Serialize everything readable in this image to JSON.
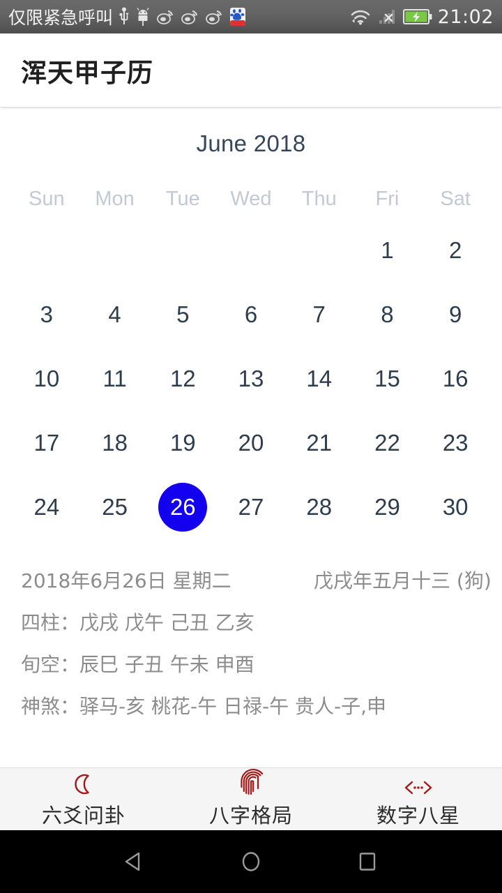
{
  "statusbar": {
    "carrier": "仅限紧急呼叫",
    "clock": "21:02",
    "left_icons": [
      "usb-icon",
      "android-robot-icon",
      "weibo-icon",
      "weibo-icon",
      "weibo-icon",
      "baidu-app-icon"
    ],
    "right_icons": [
      "wifi-icon",
      "signal-no-service-icon",
      "battery-charging-icon"
    ],
    "battery_color": "#7ac943"
  },
  "appbar": {
    "title": "浑天甲子历"
  },
  "calendar": {
    "month_title": "June 2018",
    "weekdays": [
      "Sun",
      "Mon",
      "Tue",
      "Wed",
      "Thu",
      "Fri",
      "Sat"
    ],
    "selected_day": "26",
    "selected_color": "#1300ee",
    "day_color": "#2e3d4d",
    "weeks": [
      [
        "",
        "",
        "",
        "",
        "",
        "1",
        "2"
      ],
      [
        "3",
        "4",
        "5",
        "6",
        "7",
        "8",
        "9"
      ],
      [
        "10",
        "11",
        "12",
        "13",
        "14",
        "15",
        "16"
      ],
      [
        "17",
        "18",
        "19",
        "20",
        "21",
        "22",
        "23"
      ],
      [
        "24",
        "25",
        "26",
        "27",
        "28",
        "29",
        "30"
      ]
    ]
  },
  "detail": {
    "solar_date": "2018年6月26日 星期二",
    "lunar_date": "戊戌年五月十三 (狗)",
    "sizhu": "四柱：戊戌 戊午 己丑 乙亥",
    "xunkong": "旬空：辰巳 子丑 午未 申酉",
    "shensha": "神煞：驿马-亥 桃花-午 日禄-午 贵人-子,申"
  },
  "tabbar": {
    "accent_color": "#a31818",
    "tabs": [
      {
        "label": "六爻问卦",
        "icon": "crescent-moon-icon"
      },
      {
        "label": "八字格局",
        "icon": "fingerprint-icon"
      },
      {
        "label": "数字八星",
        "icon": "code-brackets-icon"
      }
    ]
  },
  "navbar": {
    "back": "back-triangle-icon",
    "home": "home-circle-icon",
    "recents": "recents-square-icon"
  }
}
